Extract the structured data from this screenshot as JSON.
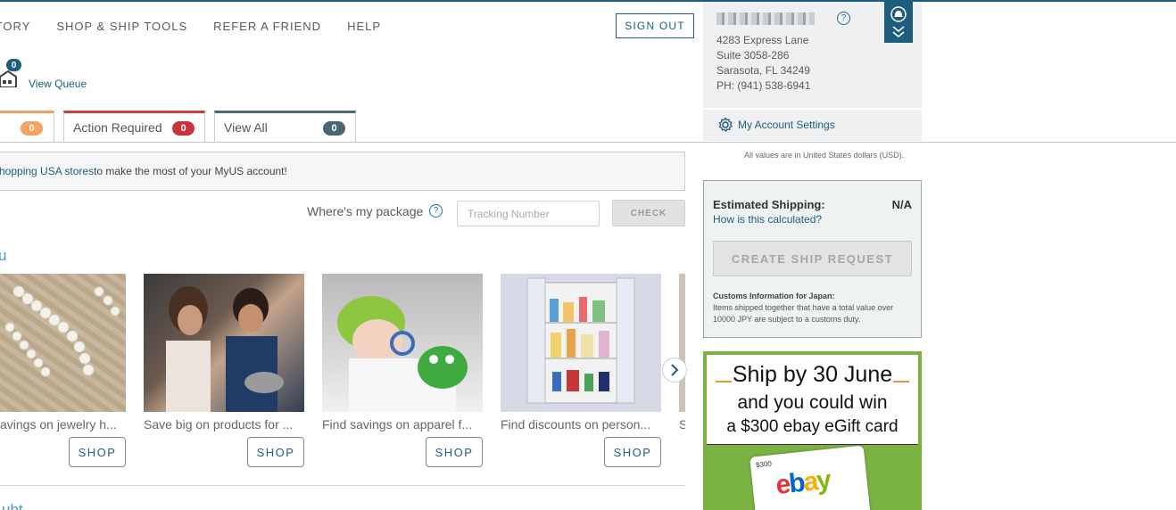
{
  "nav": {
    "items": [
      "STORY",
      "SHOP & SHIP TOOLS",
      "REFER A FRIEND",
      "HELP"
    ],
    "sign_out": "SIGN OUT"
  },
  "queue": {
    "count": "0",
    "link": "View Queue"
  },
  "tabs": [
    {
      "label": "",
      "count": "0"
    },
    {
      "label": "Action Required",
      "count": "0"
    },
    {
      "label": "View All",
      "count": "0"
    }
  ],
  "promo": {
    "link": "hopping USA stores",
    "text": " to make the most of your MyUS account!"
  },
  "tracker": {
    "label": "Where's my package",
    "help": "?",
    "placeholder": "Tracking Number",
    "button": "CHECK"
  },
  "section": {
    "fragment": "u",
    "fragment2": "ubt"
  },
  "products": [
    {
      "caption": "avings on jewelry h...",
      "button": "SHOP"
    },
    {
      "caption": "Save big on products for ...",
      "button": "SHOP"
    },
    {
      "caption": "Find savings on apparel f...",
      "button": "SHOP"
    },
    {
      "caption": "Find discounts on person...",
      "button": "SHOP"
    },
    {
      "caption": "S"
    }
  ],
  "account": {
    "address": [
      "4283 Express Lane",
      "Suite 3058-286",
      "Sarasota, FL 34249",
      "PH: (941) 538-6941"
    ],
    "help": "?",
    "settings": "My Account Settings"
  },
  "usd_note": "All values are in United States dollars (USD).",
  "estimate": {
    "title": "Estimated Shipping:",
    "value": "N/A",
    "how": "How is this calculated?",
    "button": "CREATE SHIP REQUEST",
    "customs_title": "Customs Information for Japan:",
    "customs_text": "Items shipped together that have a total value over 10000 JPY are subject to a customs duty."
  },
  "ad": {
    "line1": "Ship by 30 June",
    "line2": "and you could win",
    "line3": "a $300 ebay eGift card",
    "card_value": "$300",
    "card_logo": [
      "e",
      "b",
      "a",
      "y"
    ]
  },
  "colors": {
    "brand": "#1d5e7e",
    "link": "#1d5e7e",
    "orange_badge": "#f3a261",
    "red_badge": "#c9333a",
    "gray_badge": "#476773",
    "ad_green": "#7bb342"
  },
  "icons": [
    "warehouse-icon",
    "help-circle-icon",
    "gear-icon",
    "bell-icon",
    "double-chevron-down-icon",
    "chevron-right-icon"
  ]
}
